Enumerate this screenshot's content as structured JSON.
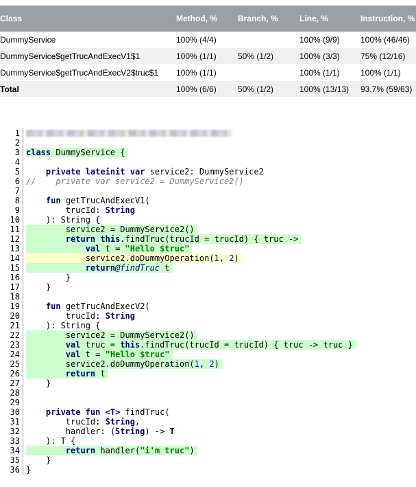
{
  "table": {
    "headers": [
      "Class",
      "Method, %",
      "Branch, %",
      "Line, %",
      "Instruction, %"
    ],
    "rows": [
      {
        "class": "DummyService",
        "method": "100% (4/4)",
        "branch": "",
        "line": "100% (9/9)",
        "instruction": "100% (46/46)"
      },
      {
        "class": "DummyService$getTrucAndExecV1$1",
        "method": "100% (1/1)",
        "branch": "50% (1/2)",
        "line": "100% (3/3)",
        "instruction": "75% (12/16)"
      },
      {
        "class": "DummyService$getTrucAndExecV2$truc$1",
        "method": "100% (1/1)",
        "branch": "",
        "line": "100% (1/1)",
        "instruction": "100% (1/1)"
      }
    ],
    "total": {
      "class": "Total",
      "method": "100% (6/6)",
      "branch": "50% (1/2)",
      "line": "100% (13/13)",
      "instruction": "93,7% (59/63)"
    }
  },
  "code": {
    "line_numbers": [
      "1",
      "2",
      "3",
      "4",
      "5",
      "6",
      "7",
      "8",
      "9",
      "10",
      "11",
      "12",
      "13",
      "14",
      "15",
      "16",
      "17",
      "18",
      "19",
      "20",
      "21",
      "22",
      "23",
      "24",
      "25",
      "26",
      "27",
      "28",
      "29",
      "30",
      "31",
      "32",
      "33",
      "34",
      "35",
      "36"
    ],
    "coverage_colors": {
      "full": "#ccffcc",
      "partial": "#ffffcc"
    },
    "tokens": {
      "kw_class": "class",
      "t_dummyservice_open": " DummyService {",
      "kw_private_lateinit_var": "private lateinit var",
      "t_service2_decl": " service2: DummyService2",
      "cmt_line6": "//    private var service2 = DummyService2()",
      "kw_fun": "fun",
      "t_getv1": " getTrucAndExecV1(",
      "t_getv2": " getTrucAndExecV2(",
      "t_trucid": "        trucId: ",
      "kw_String": "String",
      "t_close_string": "    ): String {",
      "t_service2_assign": "        service2 = DummyService2()",
      "kw_return": "return",
      "kw_this": "this",
      "t_findtruc_lambda_open": ".findTruc(trucId = trucId) { truc ->",
      "kw_val": "val",
      "t_t_eq": " t = ",
      "str_hello": "\"Hello $truc\"",
      "t_dummyop_open": "service2.doDummyOperation(",
      "num_1": "1",
      "t_comma": ", ",
      "num_2": "2",
      "t_paren_close": ")",
      "lbl_findtruc": "@findTruc",
      "t_space_t": " t",
      "t_brace_close_8": "        }",
      "t_brace_close_4": "    }",
      "t_val_truc": " truc = ",
      "t_findtruc_lambda_full": ".findTruc(trucId = trucId) { truc -> truc }",
      "kw_private_fun": "private fun",
      "kw_T_generic": "<T>",
      "t_findtruc_decl": " findTruc(",
      "t_trucid_comma": ",",
      "t_handler": "        handler: (",
      "t_arrow": ") -> ",
      "kw_T": "T",
      "t_close_T": "    ): T {",
      "t_handler_call": " handler(",
      "str_im_truc": "\"i'm truc\"",
      "t_brace_close_0": "}"
    }
  }
}
